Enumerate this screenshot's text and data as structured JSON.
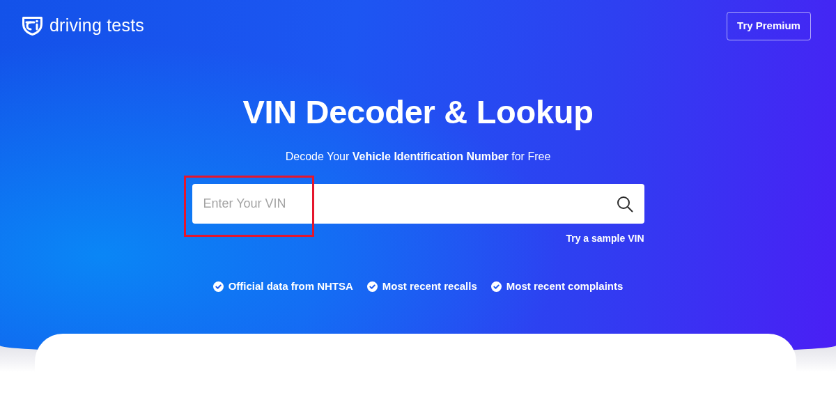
{
  "header": {
    "logo_text": "driving tests",
    "premium_button": "Try Premium"
  },
  "hero": {
    "title": "VIN Decoder & Lookup",
    "subtitle": "Decode Your **Vehicle Identification Number** for Free",
    "search": {
      "placeholder": "Enter Your VIN",
      "highlighted": true
    },
    "sample_link": "Try a sample VIN",
    "features": [
      "Official data from NHTSA",
      "Most recent recalls",
      "Most recent complaints"
    ]
  }
}
